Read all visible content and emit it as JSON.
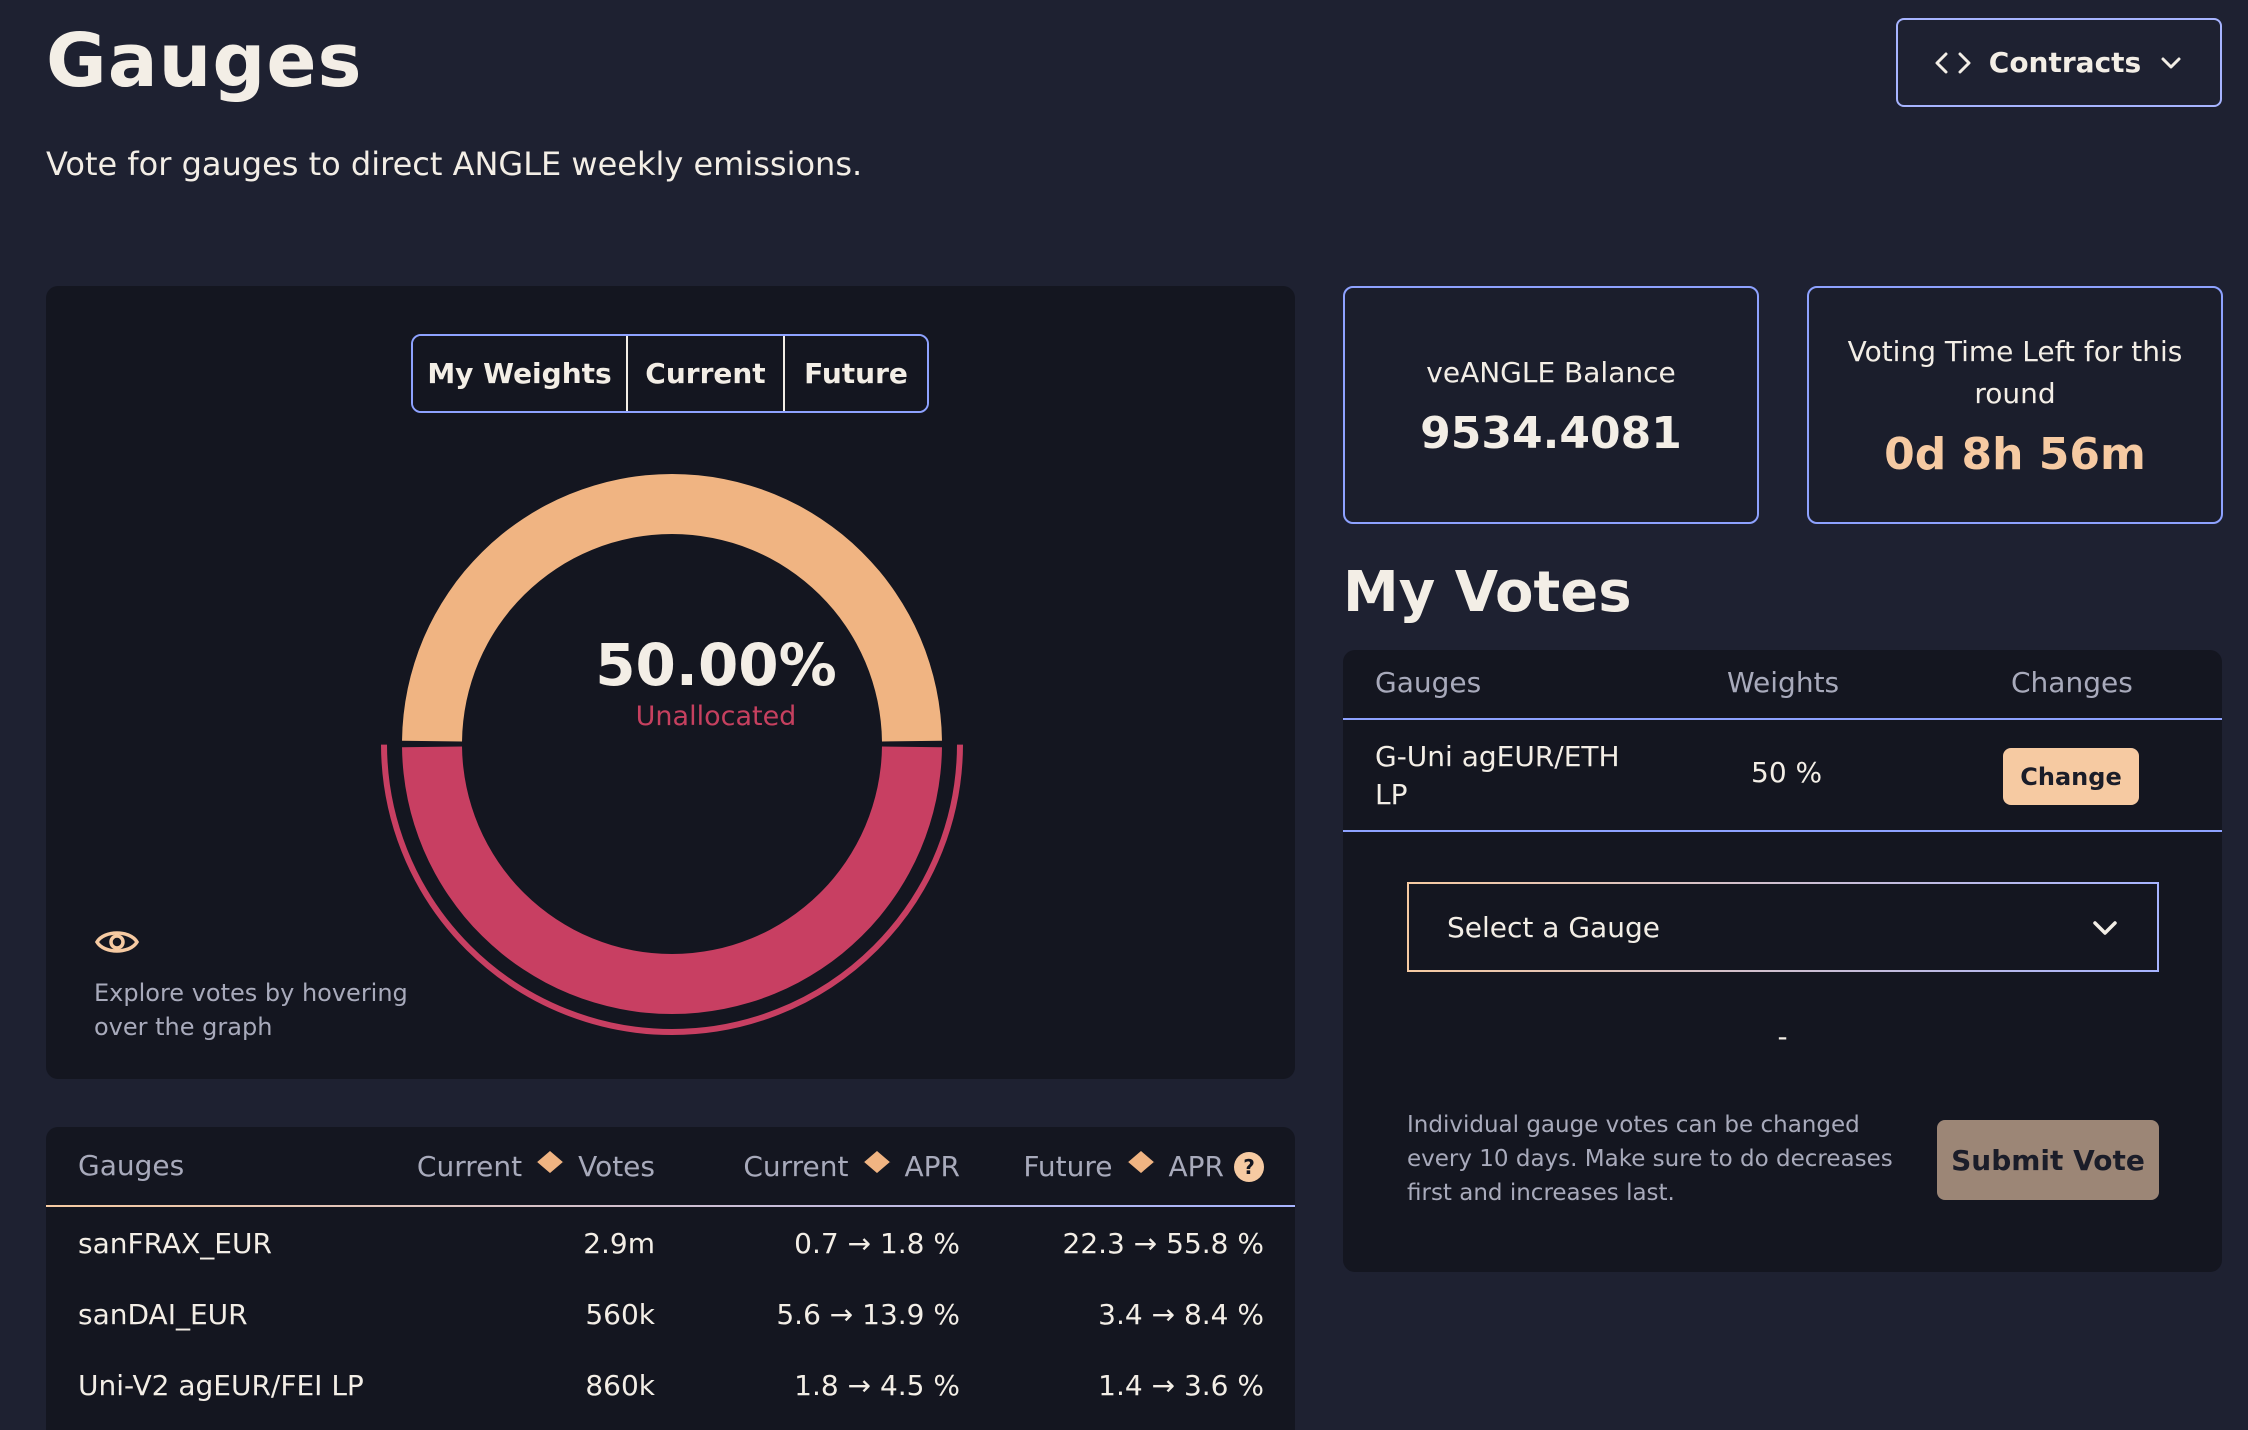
{
  "header": {
    "title": "Gauges",
    "subtitle": "Vote for gauges to direct ANGLE weekly emissions.",
    "contracts_label": "Contracts"
  },
  "chart": {
    "tabs": [
      {
        "label": "My Weights",
        "active": true
      },
      {
        "label": "Current",
        "active": false
      },
      {
        "label": "Future",
        "active": false
      }
    ],
    "center_value": "50.00%",
    "center_label": "Unallocated",
    "explore_text": "Explore votes by hovering over the graph"
  },
  "chart_data": {
    "type": "pie",
    "categories": [
      "G-Uni agEUR/ETH LP",
      "Unallocated"
    ],
    "values": [
      50,
      50
    ],
    "colors": [
      "#f0b482",
      "#c83f62"
    ],
    "highlighted": "Unallocated"
  },
  "gauges_table": {
    "headers": {
      "gauges": "Gauges",
      "current_votes_a": "Current",
      "current_votes_b": "Votes",
      "current_apr_a": "Current",
      "current_apr_b": "APR",
      "future_apr_a": "Future",
      "future_apr_b": "APR",
      "help": "?"
    },
    "rows": [
      {
        "name": "sanFRAX_EUR",
        "votes": "2.9m",
        "current_apr": "0.7 → 1.8 %",
        "future_apr": "22.3 → 55.8 %"
      },
      {
        "name": "sanDAI_EUR",
        "votes": "560k",
        "current_apr": "5.6 → 13.9 %",
        "future_apr": "3.4 → 8.4 %"
      },
      {
        "name": "Uni-V2 agEUR/FEI LP",
        "votes": "860k",
        "current_apr": "1.8 → 4.5 %",
        "future_apr": "1.4 → 3.6 %"
      }
    ]
  },
  "balance": {
    "label": "veANGLE Balance",
    "value": "9534.4081"
  },
  "voting_time": {
    "label": "Voting Time Left for this round",
    "value": "0d 8h 56m"
  },
  "my_votes": {
    "title": "My Votes",
    "headers": {
      "gauges": "Gauges",
      "weights": "Weights",
      "changes": "Changes"
    },
    "rows": [
      {
        "gauge": "G-Uni agEUR/ETH LP",
        "weight": "50 %",
        "action": "Change"
      }
    ],
    "select_placeholder": "Select a Gauge",
    "dash": "-",
    "note": "Individual gauge votes can be changed every 10 days. Make sure to do decreases first and increases last.",
    "submit_label": "Submit Vote"
  },
  "colors": {
    "background": "#1e2131",
    "panel": "#141620",
    "peach": "#f0b482",
    "rose": "#c83f62",
    "periwinkle": "#8ea2ff"
  },
  "icons": {
    "contracts": "code-brackets-icon",
    "chevron": "chevron-down-icon",
    "explore": "eye-icon",
    "sort": "sort-arrows-icon",
    "help": "help-icon"
  }
}
